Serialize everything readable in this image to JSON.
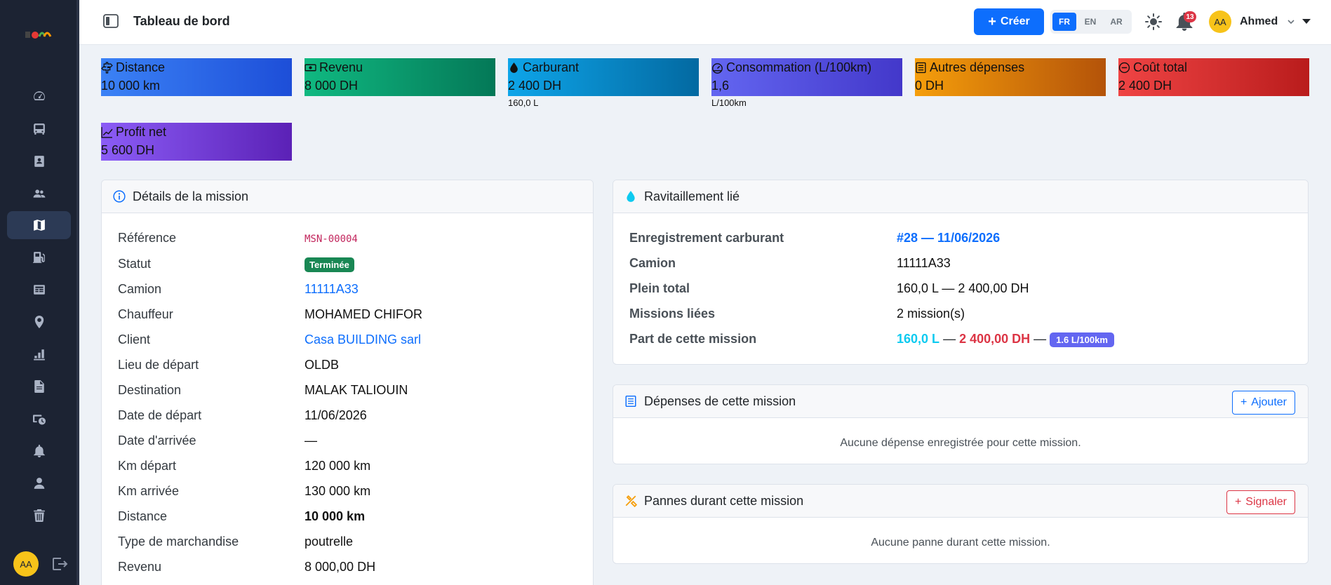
{
  "topbar": {
    "title": "Tableau de bord",
    "create_label": "Créer",
    "languages": [
      "FR",
      "EN",
      "AR"
    ],
    "active_language": "FR",
    "notification_count": "13",
    "avatar_initials": "AA",
    "user_name": "Ahmed"
  },
  "sidebar": {
    "avatar_initials": "AA",
    "icons": [
      "dashboard-icon",
      "bus-icon",
      "driver-id-icon",
      "users-icon",
      "map-icon",
      "fuel-icon",
      "expenses-icon",
      "location-icon",
      "chart-icon",
      "document-icon",
      "maintenance-icon",
      "bell-icon",
      "user-icon",
      "trash-icon"
    ],
    "active_icon": "map-icon"
  },
  "stats": [
    {
      "label": "Distance",
      "value": "10 000 km",
      "sub": "",
      "icon": "route-icon",
      "color_from": "#3b82f6",
      "color_to": "#1d4ed8"
    },
    {
      "label": "Revenu",
      "value": "8 000 DH",
      "sub": "",
      "icon": "money-icon",
      "color_from": "#10b981",
      "color_to": "#047857"
    },
    {
      "label": "Carburant",
      "value": "2 400 DH",
      "sub": "160,0 L",
      "icon": "droplet-icon",
      "color_from": "#0ea5e9",
      "color_to": "#0369a1"
    },
    {
      "label": "Consommation (L/100km)",
      "value": "1,6",
      "sub": "L/100km",
      "icon": "speedometer-icon",
      "color_from": "#6366f1",
      "color_to": "#4338ca"
    },
    {
      "label": "Autres dépenses",
      "value": "0 DH",
      "sub": "",
      "icon": "receipt-icon",
      "color_from": "#f59e0b",
      "color_to": "#b45309"
    },
    {
      "label": "Coût total",
      "value": "2 400 DH",
      "sub": "",
      "icon": "minus-circle-icon",
      "color_from": "#ef4444",
      "color_to": "#b91c1c"
    },
    {
      "label": "Profit net",
      "value": "5 600 DH",
      "sub": "",
      "icon": "trend-icon",
      "color_from": "#8b5cf6",
      "color_to": "#5b21b6"
    }
  ],
  "mission": {
    "title": "Détails de la mission",
    "rows": [
      {
        "label": "Référence",
        "value": "MSN-00004"
      },
      {
        "label": "Statut",
        "value": "Terminée"
      },
      {
        "label": "Camion",
        "value": "11111A33"
      },
      {
        "label": "Chauffeur",
        "value": "MOHAMED CHIFOR"
      },
      {
        "label": "Client",
        "value": "Casa BUILDING sarl"
      },
      {
        "label": "Lieu de départ",
        "value": "OLDB"
      },
      {
        "label": "Destination",
        "value": "MALAK TALIOUIN"
      },
      {
        "label": "Date de départ",
        "value": "11/06/2026"
      },
      {
        "label": "Date d'arrivée",
        "value": "—"
      },
      {
        "label": "Km départ",
        "value": "120 000 km"
      },
      {
        "label": "Km arrivée",
        "value": "130 000 km"
      },
      {
        "label": "Distance",
        "value": "10 000 km"
      },
      {
        "label": "Type de marchandise",
        "value": "poutrelle"
      },
      {
        "label": "Revenu",
        "value": "8 000,00 DH"
      }
    ]
  },
  "refuel": {
    "title": "Ravitaillement lié",
    "rows": [
      {
        "label": "Enregistrement carburant",
        "value": "#28 — 11/06/2026"
      },
      {
        "label": "Camion",
        "value": "11111A33"
      },
      {
        "label": "Plein total",
        "value": "160,0 L — 2 400,00 DH"
      },
      {
        "label": "Missions liées",
        "value": "2 mission(s)"
      },
      {
        "label": "Part de cette mission",
        "value": ""
      }
    ],
    "share_liters": "160,0 L",
    "share_sep1": "—",
    "share_amount": "2 400,00 DH",
    "share_sep2": "—",
    "share_rate": "1.6 L/100km"
  },
  "expenses": {
    "title": "Dépenses de cette mission",
    "add_label": "Ajouter",
    "empty": "Aucune dépense enregistrée pour cette mission."
  },
  "breakdowns": {
    "title": "Pannes durant cette mission",
    "report_label": "Signaler",
    "empty": "Aucune panne durant cette mission."
  }
}
